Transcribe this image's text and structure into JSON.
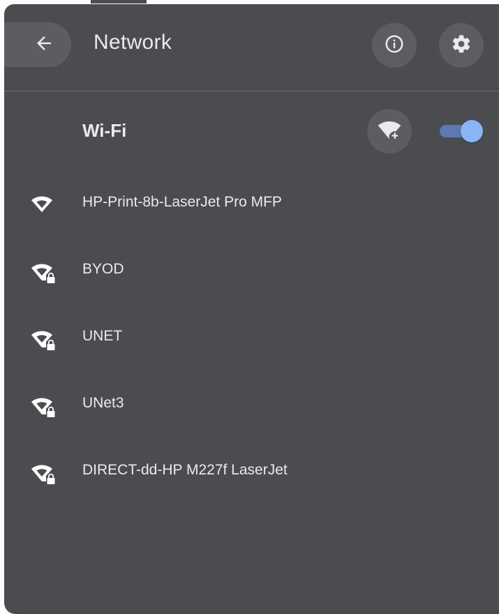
{
  "header": {
    "title": "Network",
    "back_icon": "arrow-back-icon",
    "info_icon": "info-icon",
    "settings_icon": "gear-icon"
  },
  "wifi": {
    "label": "Wi-Fi",
    "add_icon": "add-wifi-icon",
    "enabled": true
  },
  "networks": [
    {
      "name": "HP-Print-8b-LaserJet Pro MFP",
      "secured": false,
      "icon": "wifi-icon"
    },
    {
      "name": "BYOD",
      "secured": true,
      "icon": "wifi-lock-icon"
    },
    {
      "name": "UNET",
      "secured": true,
      "icon": "wifi-lock-icon"
    },
    {
      "name": "UNet3",
      "secured": true,
      "icon": "wifi-lock-icon"
    },
    {
      "name": "DIRECT-dd-HP M227f LaserJet",
      "secured": true,
      "icon": "wifi-lock-icon"
    }
  ],
  "colors": {
    "panel_bg": "#4b4c4f",
    "button_bg": "#5c5d60",
    "text": "#e8eaed",
    "toggle_on": "#8ab4f8"
  }
}
